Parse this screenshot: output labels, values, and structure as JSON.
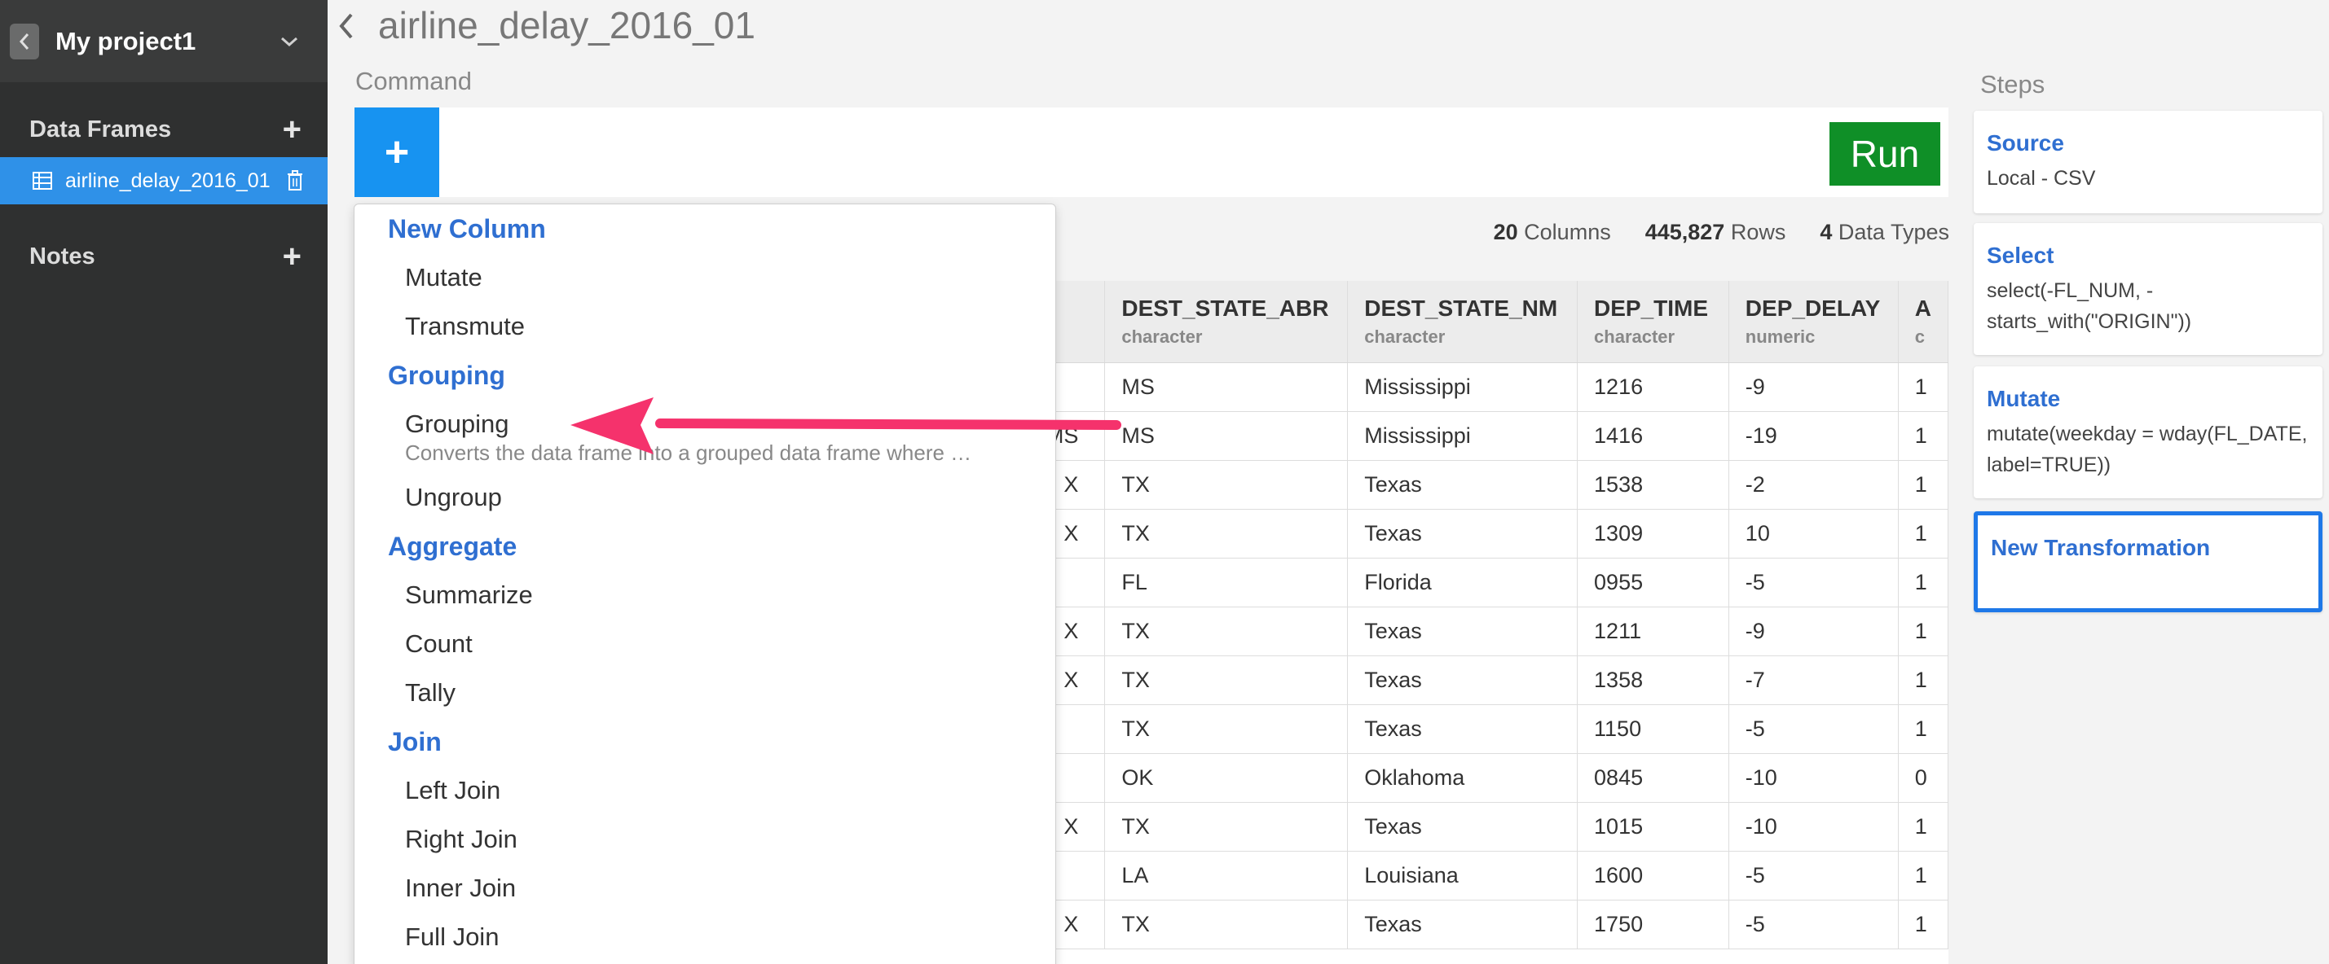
{
  "sidebar": {
    "project_name": "My project1",
    "data_frames_label": "Data Frames",
    "data_frame_item": "airline_delay_2016_01",
    "notes_label": "Notes"
  },
  "main": {
    "title": "airline_delay_2016_01",
    "command_label": "Command",
    "add_button": "+",
    "run_button": "Run",
    "stats": {
      "columns_count": "20",
      "columns_label": "Columns",
      "rows_count": "445,827",
      "rows_label": "Rows",
      "types_count": "4",
      "types_label": "Data Types"
    }
  },
  "table": {
    "columns": [
      {
        "name": "DEST_STATE_ABR",
        "type": "character"
      },
      {
        "name": "DEST_STATE_NM",
        "type": "character"
      },
      {
        "name": "DEP_TIME",
        "type": "character"
      },
      {
        "name": "DEP_DELAY",
        "type": "numeric"
      },
      {
        "name": "A",
        "type": "c"
      }
    ],
    "rows": [
      {
        "lead": "",
        "abr": "MS",
        "nm": "Mississippi",
        "time": "1216",
        "delay": "-9",
        "extra": "1"
      },
      {
        "lead": "MS",
        "abr": "MS",
        "nm": "Mississippi",
        "time": "1416",
        "delay": "-19",
        "extra": "1"
      },
      {
        "lead": "X",
        "abr": "TX",
        "nm": "Texas",
        "time": "1538",
        "delay": "-2",
        "extra": "1"
      },
      {
        "lead": "X",
        "abr": "TX",
        "nm": "Texas",
        "time": "1309",
        "delay": "10",
        "extra": "1"
      },
      {
        "lead": "",
        "abr": "FL",
        "nm": "Florida",
        "time": "0955",
        "delay": "-5",
        "extra": "1"
      },
      {
        "lead": "X",
        "abr": "TX",
        "nm": "Texas",
        "time": "1211",
        "delay": "-9",
        "extra": "1"
      },
      {
        "lead": "X",
        "abr": "TX",
        "nm": "Texas",
        "time": "1358",
        "delay": "-7",
        "extra": "1"
      },
      {
        "lead": "",
        "abr": "TX",
        "nm": "Texas",
        "time": "1150",
        "delay": "-5",
        "extra": "1"
      },
      {
        "lead": "",
        "abr": "OK",
        "nm": "Oklahoma",
        "time": "0845",
        "delay": "-10",
        "extra": "0"
      },
      {
        "lead": "X",
        "abr": "TX",
        "nm": "Texas",
        "time": "1015",
        "delay": "-10",
        "extra": "1"
      },
      {
        "lead": "",
        "abr": "LA",
        "nm": "Louisiana",
        "time": "1600",
        "delay": "-5",
        "extra": "1"
      },
      {
        "lead": "X",
        "abr": "TX",
        "nm": "Texas",
        "time": "1750",
        "delay": "-5",
        "extra": "1"
      }
    ]
  },
  "menu": {
    "new_column": "New Column",
    "mutate": "Mutate",
    "transmute": "Transmute",
    "grouping_group": "Grouping",
    "grouping": "Grouping",
    "grouping_desc": "Converts the data frame into a grouped data frame where …",
    "ungroup": "Ungroup",
    "aggregate": "Aggregate",
    "summarize": "Summarize",
    "count": "Count",
    "tally": "Tally",
    "join": "Join",
    "left_join": "Left Join",
    "right_join": "Right Join",
    "inner_join": "Inner Join",
    "full_join": "Full Join"
  },
  "steps": {
    "label": "Steps",
    "items": [
      {
        "title": "Source",
        "body": "Local - CSV"
      },
      {
        "title": "Select",
        "body": "select(-FL_NUM, -starts_with(\"ORIGIN\"))"
      },
      {
        "title": "Mutate",
        "body": "mutate(weekday = wday(FL_DATE, label=TRUE))"
      },
      {
        "title": "New Transformation",
        "body": ""
      }
    ]
  },
  "colors": {
    "sidebar_bg": "#2f3030",
    "accent_blue": "#1793f1",
    "run_green": "#0f8f27",
    "menu_group_blue": "#2f6fd1",
    "annotation_pink": "#f5326c"
  }
}
